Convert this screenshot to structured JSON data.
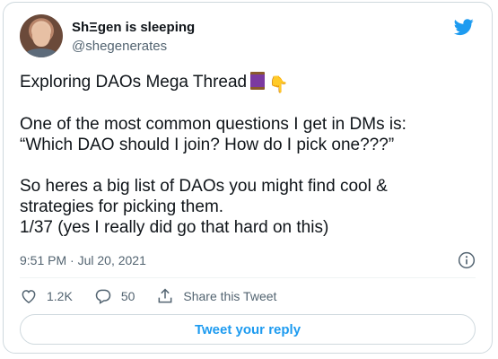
{
  "author": {
    "name": "ShΞgen is sleeping",
    "handle": "@shegenerates"
  },
  "tweet": {
    "lines": [
      "Exploring DAOs Mega Thread",
      "One of the most common questions I get in DMs is:",
      "“Which DAO should I join? How do I pick one???”",
      "So heres a big list of DAOs you might find cool &",
      "strategies for picking them.",
      "1/37 (yes I really did go that hard on this)"
    ],
    "emojis": [
      "thread-emoji",
      "point-down-emoji"
    ],
    "timestamp": "9:51 PM · Jul 20, 2021"
  },
  "actions": {
    "likes": "1.2K",
    "replies": "50",
    "share_label": "Share this Tweet"
  },
  "reply_button_label": "Tweet your reply",
  "colors": {
    "accent": "#1d9bf0",
    "muted_text": "#536471",
    "border": "#cfd9de"
  }
}
